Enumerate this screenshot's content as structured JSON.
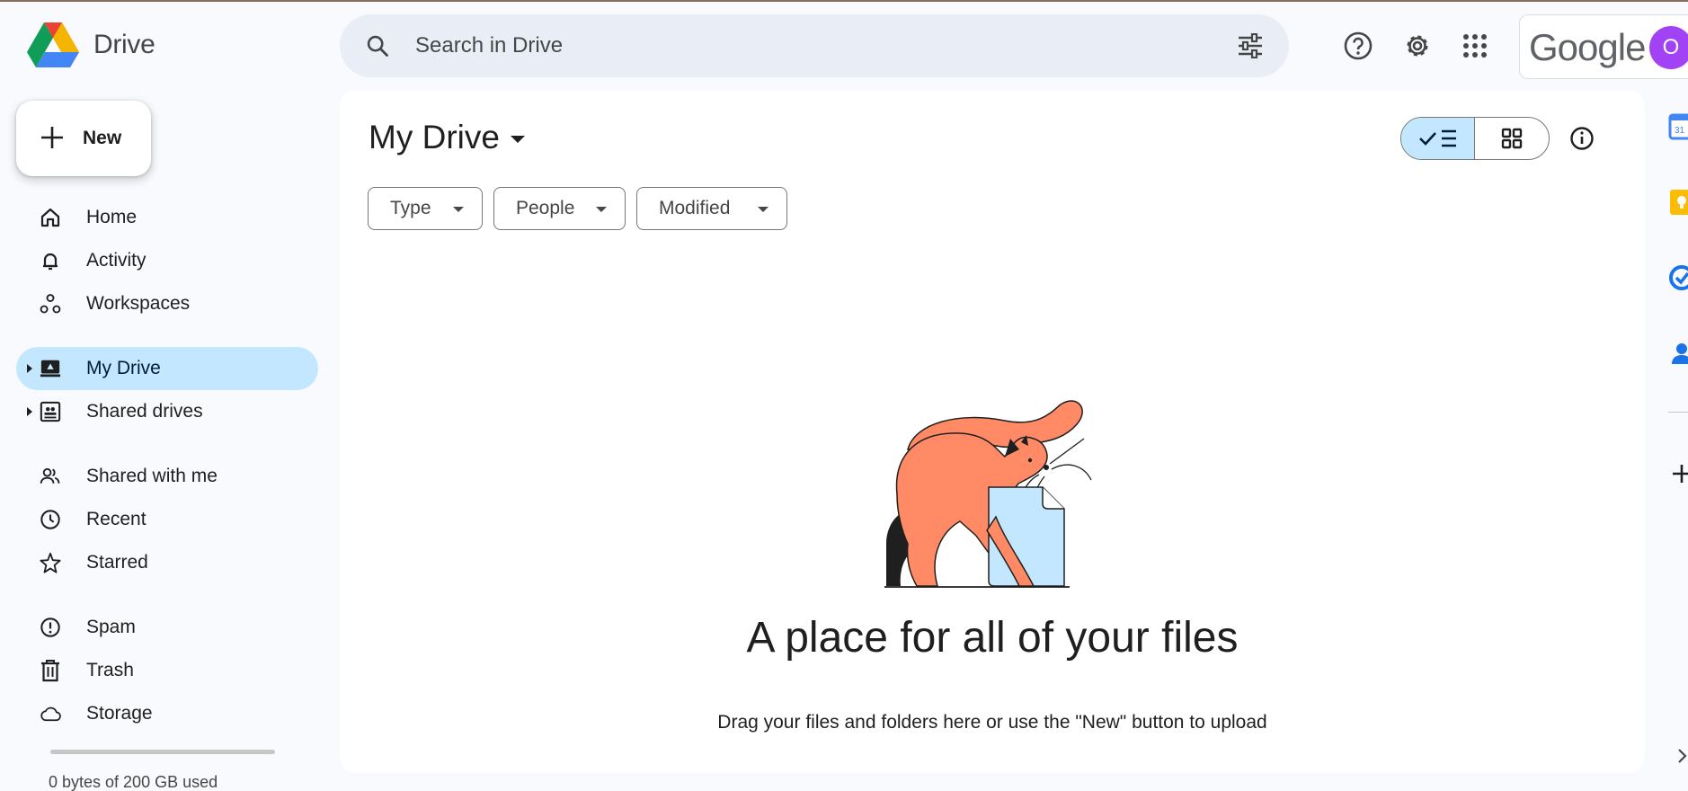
{
  "app": {
    "name": "Drive",
    "brand_colors": {
      "blue": "#4285f4",
      "green": "#0f9d58",
      "yellow": "#f4b400",
      "red": "#db4437"
    }
  },
  "search": {
    "placeholder": "Search in Drive",
    "icon": "search-icon",
    "filter_icon": "search-options-icon"
  },
  "header_icons": [
    "help-icon",
    "settings-icon",
    "apps-grid-icon"
  ],
  "account": {
    "brand": "Google",
    "avatar_initial": "O",
    "avatar_color": "#a142f4"
  },
  "new_button": {
    "label": "New"
  },
  "sidebar": {
    "items": [
      {
        "label": "Home",
        "icon": "home-icon"
      },
      {
        "label": "Activity",
        "icon": "bell-icon"
      },
      {
        "label": "Workspaces",
        "icon": "workspaces-icon"
      },
      {
        "label": "My Drive",
        "icon": "my-drive-icon",
        "active": true,
        "expandable": true
      },
      {
        "label": "Shared drives",
        "icon": "shared-drives-icon",
        "expandable": true
      },
      {
        "label": "Shared with me",
        "icon": "people-icon"
      },
      {
        "label": "Recent",
        "icon": "clock-icon"
      },
      {
        "label": "Starred",
        "icon": "star-icon"
      },
      {
        "label": "Spam",
        "icon": "spam-icon"
      },
      {
        "label": "Trash",
        "icon": "trash-icon"
      },
      {
        "label": "Storage",
        "icon": "cloud-icon"
      }
    ]
  },
  "storage": {
    "used_fraction": 0.0,
    "text": "0 bytes of 200 GB used"
  },
  "main": {
    "title": "My Drive",
    "view_mode": "list",
    "filters": [
      {
        "label": "Type"
      },
      {
        "label": "People"
      },
      {
        "label": "Modified"
      }
    ],
    "empty_state": {
      "title": "A place for all of your files",
      "subtitle": "Drag your files and folders here or use the \"New\" button to upload"
    }
  },
  "right_rail": [
    "calendar-icon",
    "keep-icon",
    "tasks-icon",
    "contacts-icon",
    "add-icon",
    "expand-icon"
  ]
}
